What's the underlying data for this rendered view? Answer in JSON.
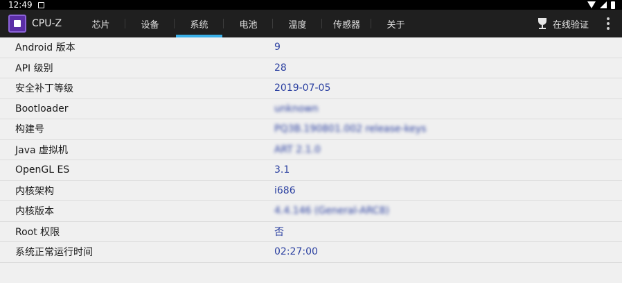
{
  "statusbar": {
    "time": "12:49"
  },
  "app": {
    "name": "CPU-Z"
  },
  "tabs": [
    {
      "label": "芯片"
    },
    {
      "label": "设备"
    },
    {
      "label": "系统"
    },
    {
      "label": "电池"
    },
    {
      "label": "温度"
    },
    {
      "label": "传感器"
    },
    {
      "label": "关于"
    }
  ],
  "active_tab": "系统",
  "actions": {
    "verify_label": "在线验证"
  },
  "rows": [
    {
      "label": "Android 版本",
      "value": "9"
    },
    {
      "label": "API 级别",
      "value": "28"
    },
    {
      "label": "安全补丁等级",
      "value": "2019-07-05"
    },
    {
      "label": "Bootloader",
      "value": "unknown"
    },
    {
      "label": "构建号",
      "value": "PQ3B.190801.002 release-keys"
    },
    {
      "label": "Java 虚拟机",
      "value": "ART 2.1.0"
    },
    {
      "label": "OpenGL ES",
      "value": "3.1"
    },
    {
      "label": "内核架构",
      "value": "i686"
    },
    {
      "label": "内核版本",
      "value": "4.4.146 (General-ARC8)"
    },
    {
      "label": "Root 权限",
      "value": "否"
    },
    {
      "label": "系统正常运行时间",
      "value": "02:27:00"
    }
  ],
  "colors": {
    "appbar": "#1f1f1f",
    "accent": "#3ab0e8",
    "value_text": "#2a3fa0",
    "background": "#f0f0f0"
  }
}
